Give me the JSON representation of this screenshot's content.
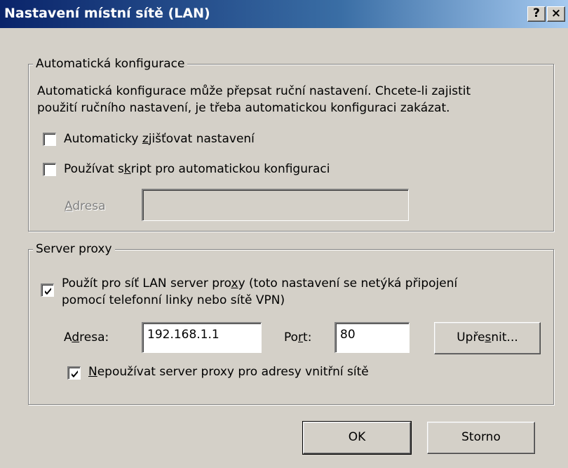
{
  "window": {
    "title": "Nastavení místní sítě (LAN)",
    "help_button": "?",
    "close_button": "×"
  },
  "auto_config": {
    "legend": "Automatická konfigurace",
    "description_line1": "Automatická konfigurace může přepsat ruční nastavení. Chcete-li zajistit",
    "description_line2": "použití ručního nastavení, je třeba automatickou konfiguraci zakázat.",
    "detect_checkbox": {
      "label_pre": "Automaticky ",
      "label_u": "z",
      "label_post": "jišťovat nastavení",
      "checked": false
    },
    "script_checkbox": {
      "label_pre": "Používat s",
      "label_u": "k",
      "label_post": "ript pro automatickou konfiguraci",
      "checked": false
    },
    "address_label_u": "A",
    "address_label_rest": "dresa",
    "address_value": ""
  },
  "proxy": {
    "legend": "Server proxy",
    "use_proxy_checkbox": {
      "line1_pre": "Použít pro síť LAN server pro",
      "line1_u": "x",
      "line1_post": "y (toto nastavení se netýká připojení",
      "line2": "pomocí telefonní linky nebo sítě VPN)",
      "checked": true
    },
    "address_label_pre": "A",
    "address_label_u": "d",
    "address_label_post": "resa:",
    "address_value": "192.168.1.1",
    "port_label_pre": "Po",
    "port_label_u": "r",
    "port_label_post": "t:",
    "port_value": "80",
    "advanced_pre": "Upře",
    "advanced_u": "s",
    "advanced_post": "nit...",
    "bypass_checkbox": {
      "label_u": "N",
      "label_post": "epoužívat server proxy pro adresy vnitřní sítě",
      "checked": true
    }
  },
  "buttons": {
    "ok": "OK",
    "cancel": "Storno"
  },
  "colors": {
    "dialog_bg": "#d4d0c8",
    "title_start": "#0a246a",
    "title_end": "#a6caf0"
  }
}
